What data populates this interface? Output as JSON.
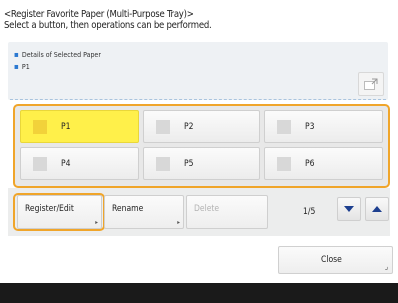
{
  "header": {
    "title": "<Register Favorite Paper (Multi-Purpose Tray)>",
    "subtitle": "Select a button, then operations can be performed."
  },
  "details": {
    "line1": "Details of Selected Paper",
    "line2": "P1"
  },
  "paper_buttons": [
    {
      "label": "P1",
      "selected": true
    },
    {
      "label": "P2",
      "selected": false
    },
    {
      "label": "P3",
      "selected": false
    },
    {
      "label": "P4",
      "selected": false
    },
    {
      "label": "P5",
      "selected": false
    },
    {
      "label": "P6",
      "selected": false
    }
  ],
  "actions": {
    "register_edit": "Register/Edit",
    "rename": "Rename",
    "delete": "Delete"
  },
  "pagination": {
    "text": "1/5"
  },
  "close_label": "Close",
  "colors": {
    "highlight": "#f0a52a",
    "selected": "#fff04a",
    "accent_arrow": "#1d3f8f"
  },
  "icons": [
    "zoom-expand-icon",
    "arrow-down-icon",
    "arrow-up-icon",
    "corner-indicator-icon"
  ]
}
